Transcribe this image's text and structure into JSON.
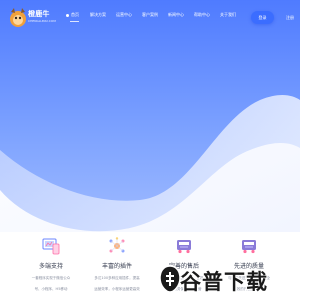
{
  "header": {
    "logo_name": "橙鹿牛",
    "logo_sub": "CHENGLUNIU.COM",
    "nav": [
      {
        "label": "首页",
        "active": true
      },
      {
        "label": "解决方案",
        "active": false
      },
      {
        "label": "运营中心",
        "active": false
      },
      {
        "label": "客户案例",
        "active": false
      },
      {
        "label": "新闻中心",
        "active": false
      },
      {
        "label": "帮助中心",
        "active": false
      },
      {
        "label": "关于我们",
        "active": false
      }
    ],
    "login_label": "登录",
    "signup_label": "注册"
  },
  "features": [
    {
      "title": "多端支持",
      "desc1": "一套程序实现于微信公众",
      "desc2": "号、小程序、H5移动",
      "icon": "multi-device-icon"
    },
    {
      "title": "丰富的插件",
      "desc1": "多达100多种应用插件，提高",
      "desc2": "运营效率，小程序运营更高效",
      "icon": "plugin-network-icon"
    },
    {
      "title": "完善的售后",
      "desc1": "技术支持售后保障，全程",
      "desc2": "指导服务保驾护航运营",
      "icon": "service-truck-icon"
    },
    {
      "title": "先进的质量",
      "desc1": "与国内先进技术，稳定安全",
      "desc2": "高效的开发运维保障",
      "icon": "quality-truck-icon"
    }
  ],
  "watermark": {
    "text": "谷普下载"
  },
  "colors": {
    "accent": "#3b6dff",
    "hero_top": "#5a86ff",
    "hero_mid": "#8fb2ff"
  }
}
